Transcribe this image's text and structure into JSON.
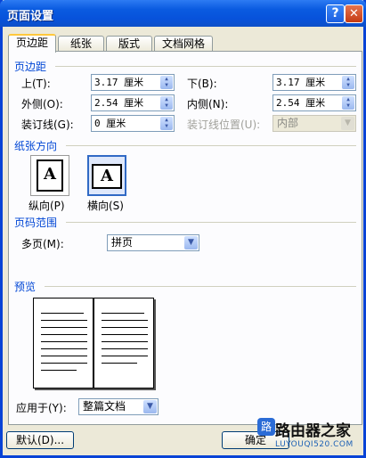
{
  "window": {
    "title": "页面设置",
    "help_glyph": "?",
    "close_glyph": "✕"
  },
  "tabs": [
    "页边距",
    "纸张",
    "版式",
    "文档网格"
  ],
  "margins": {
    "section_title": "页边距",
    "top": {
      "label": "上(T):",
      "value": "3.17 厘米"
    },
    "bottom": {
      "label": "下(B):",
      "value": "3.17 厘米"
    },
    "outside": {
      "label": "外侧(O):",
      "value": "2.54 厘米"
    },
    "inside": {
      "label": "内侧(N):",
      "value": "2.54 厘米"
    },
    "gutter": {
      "label": "装订线(G):",
      "value": "0 厘米"
    },
    "gutter_position": {
      "label": "装订线位置(U):",
      "value": "内部"
    }
  },
  "orientation": {
    "section_title": "纸张方向",
    "portrait": {
      "label": "纵向(P)",
      "glyph": "A"
    },
    "landscape": {
      "label": "横向(S)",
      "glyph": "A"
    },
    "selected": "landscape"
  },
  "pages": {
    "section_title": "页码范围",
    "multiple_label": "多页(M):",
    "multiple_value": "拼页"
  },
  "preview": {
    "section_title": "预览"
  },
  "apply": {
    "label": "应用于(Y):",
    "value": "整篇文档"
  },
  "buttons": {
    "default": "默认(D)...",
    "ok": "确定"
  },
  "watermark": {
    "logo": "路",
    "chinese": "路由器之家",
    "english": "LUYOUQI520.COM"
  }
}
